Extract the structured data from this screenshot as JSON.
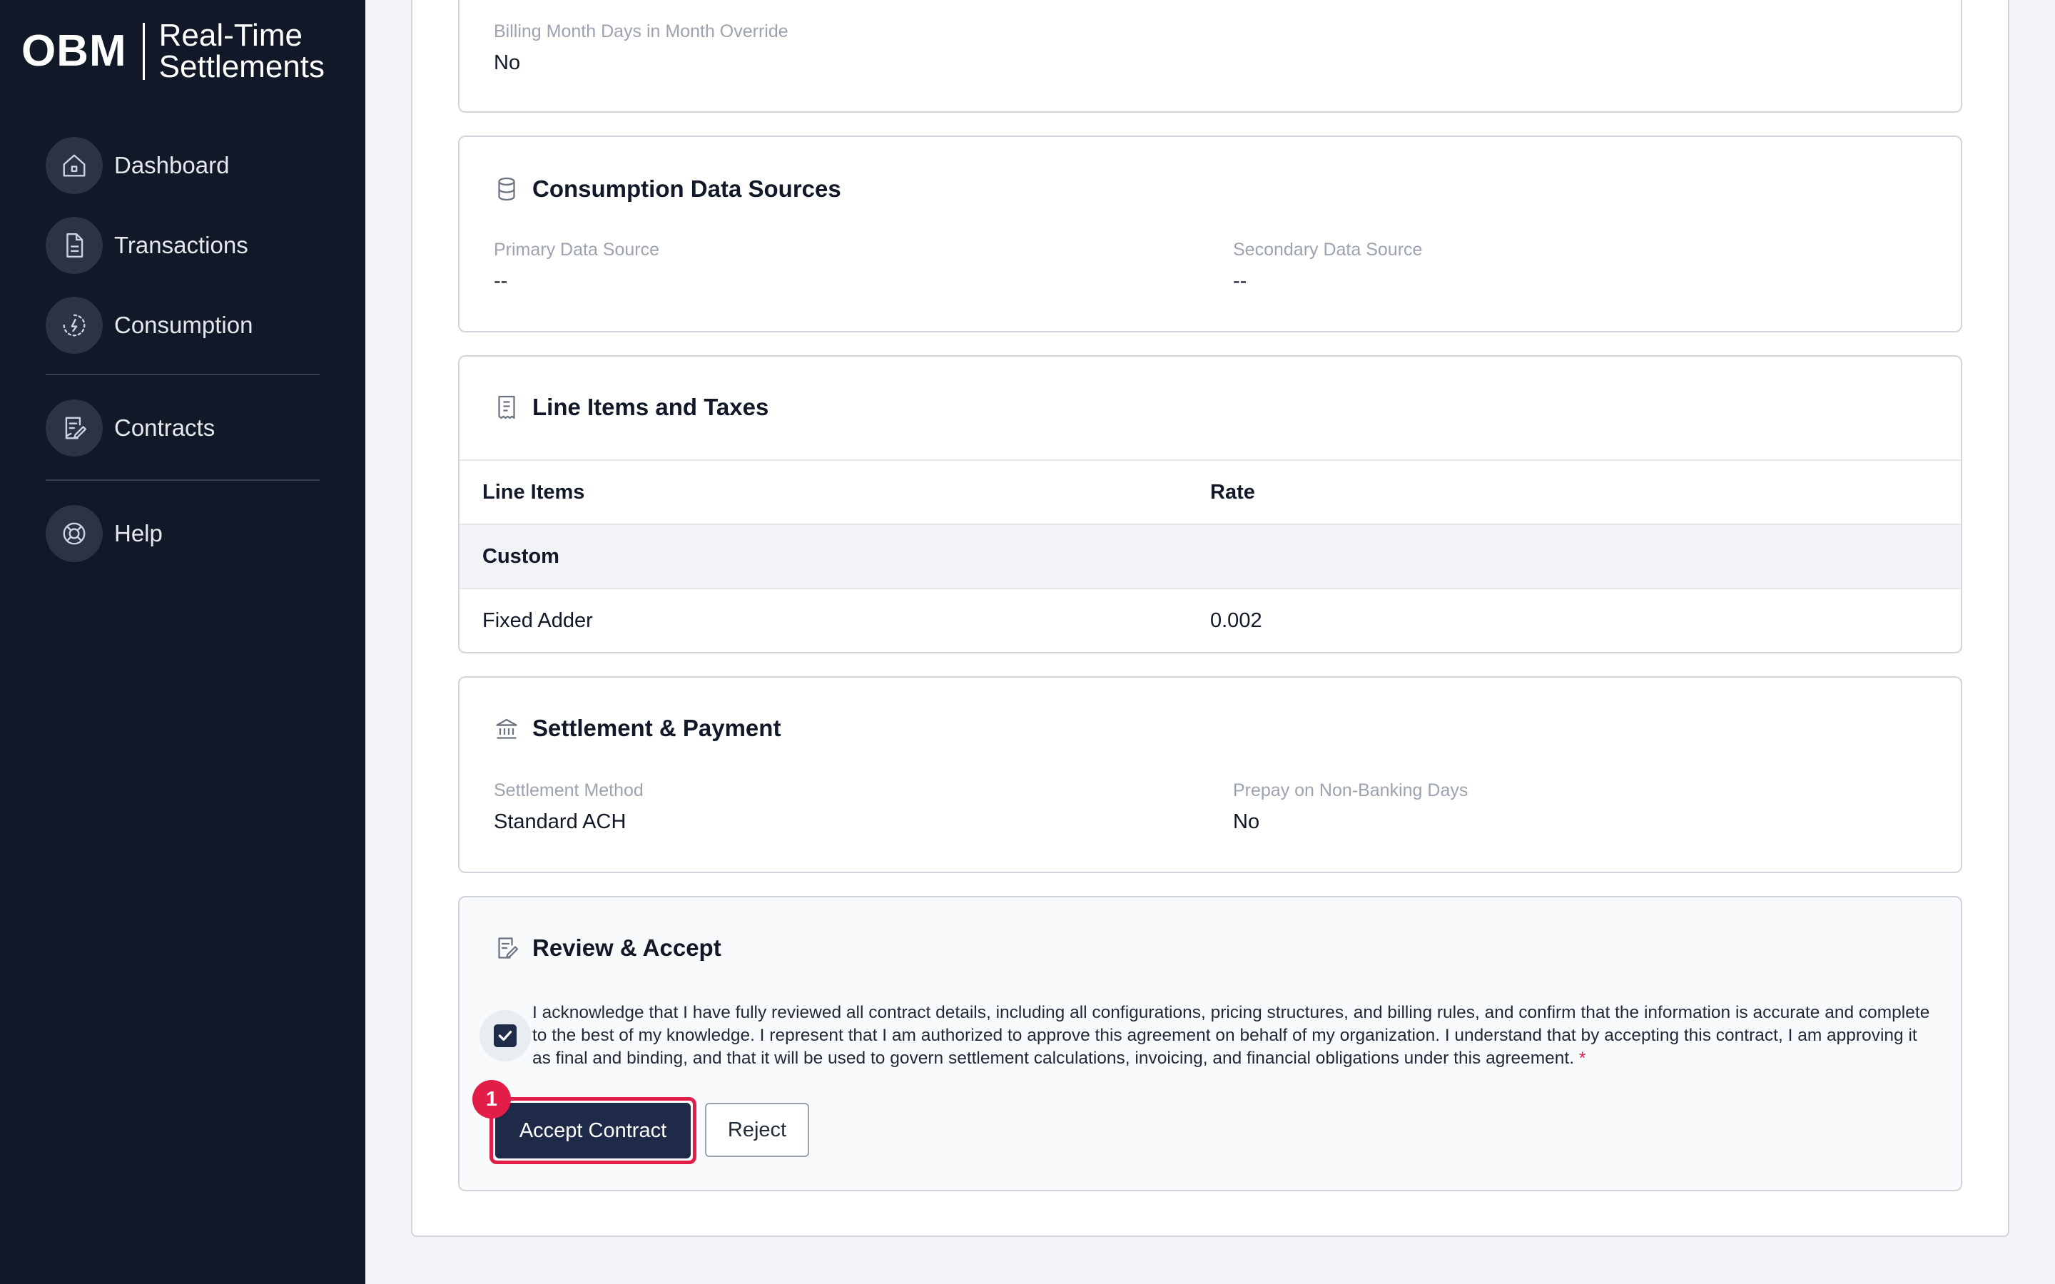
{
  "brand": {
    "logo": "OBM",
    "product_line1": "Real-Time",
    "product_line2": "Settlements"
  },
  "sidebar": {
    "items": [
      {
        "label": "Dashboard",
        "icon": "home-icon"
      },
      {
        "label": "Transactions",
        "icon": "document-icon"
      },
      {
        "label": "Consumption",
        "icon": "meter-icon"
      },
      {
        "label": "Contracts",
        "icon": "contract-edit-icon"
      },
      {
        "label": "Help",
        "icon": "lifebuoy-icon"
      }
    ]
  },
  "billing": {
    "days_override_label": "Billing Month Days in Month Override",
    "days_override_value": "No"
  },
  "consumption_sources": {
    "title": "Consumption Data Sources",
    "primary_label": "Primary Data Source",
    "primary_value": "--",
    "secondary_label": "Secondary Data Source",
    "secondary_value": "--"
  },
  "line_items": {
    "title": "Line Items and Taxes",
    "columns": [
      "Line Items",
      "Rate"
    ],
    "group": "Custom",
    "rows": [
      {
        "name": "Fixed Adder",
        "rate": "0.002"
      }
    ]
  },
  "settlement": {
    "title": "Settlement & Payment",
    "method_label": "Settlement Method",
    "method_value": "Standard ACH",
    "prepay_label": "Prepay on Non-Banking Days",
    "prepay_value": "No"
  },
  "review": {
    "title": "Review & Accept",
    "acknowledgement": "I acknowledge that I have fully reviewed all contract details, including all configurations, pricing structures, and billing rules, and confirm that the information is accurate and complete to the best of my knowledge. I represent that I am authorized to approve this agreement on behalf of my organization. I understand that by accepting this contract, I am approving it as final and binding, and that it will be used to govern settlement calculations, invoicing, and financial obligations under this agreement.",
    "required_marker": "*",
    "checked": true,
    "accept_label": "Accept Contract",
    "reject_label": "Reject",
    "badge": "1"
  },
  "colors": {
    "sidebar_bg": "#111827",
    "primary_button": "#1e2a47",
    "highlight": "#e11d48"
  }
}
